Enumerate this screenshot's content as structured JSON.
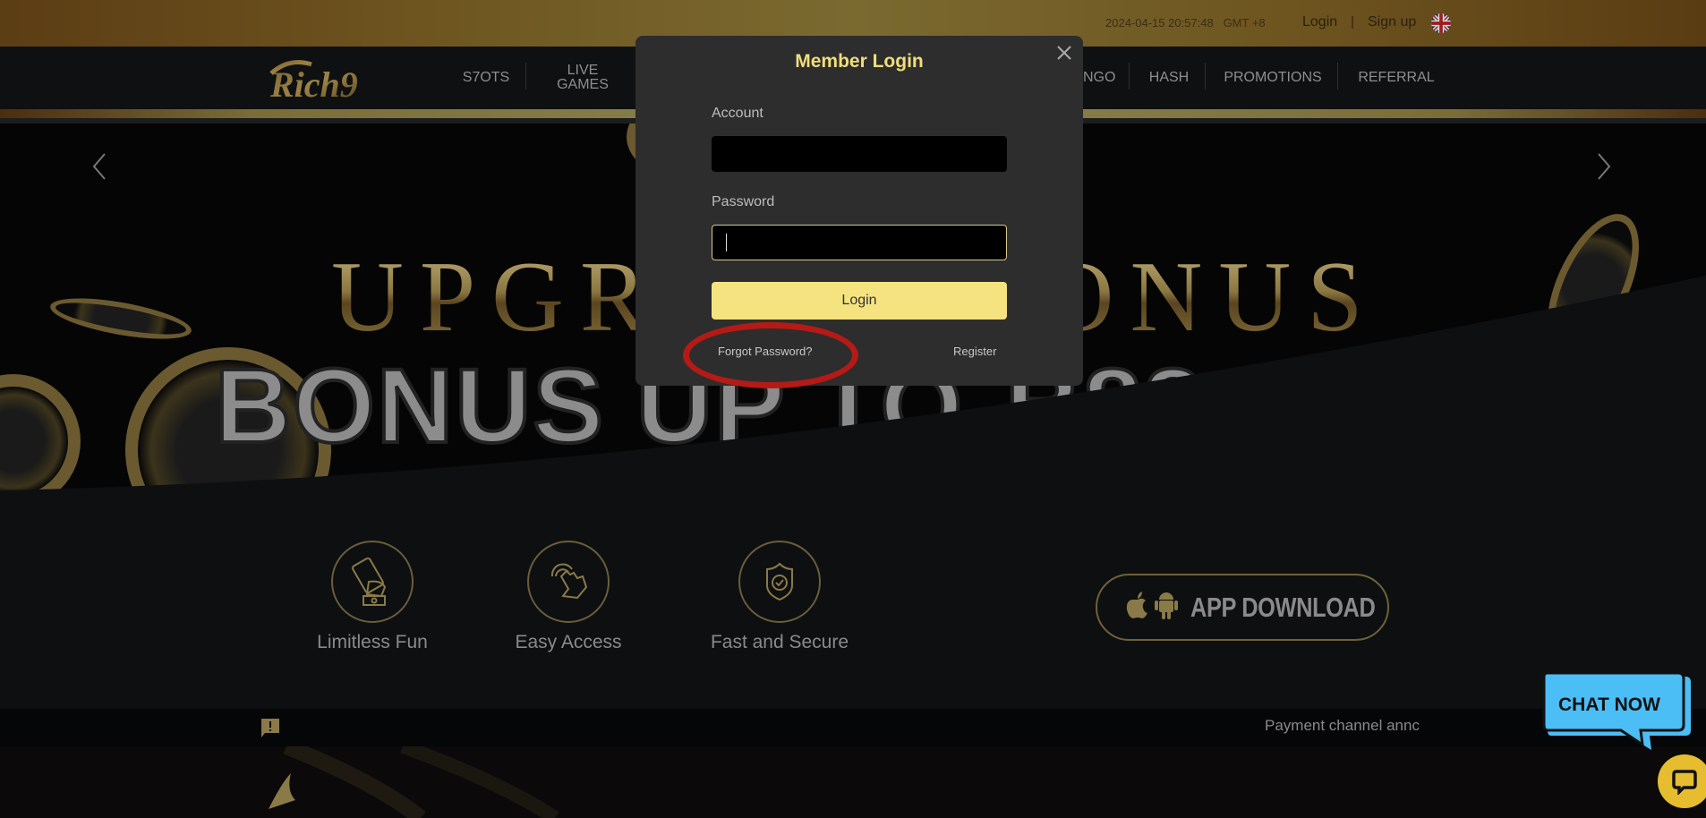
{
  "topbar": {
    "datetime": "2024-04-15 20:57:48",
    "timezone": "GMT +8",
    "login_label": "Login",
    "separator": "|",
    "signup_label": "Sign up",
    "language_icon": "uk-flag-icon"
  },
  "nav": {
    "logo_text": "Rich9",
    "items": [
      {
        "label": "S7OTS"
      },
      {
        "label": "LIVE GAMES"
      },
      {
        "label": "NGO"
      },
      {
        "label": "HASH"
      },
      {
        "label": "PROMOTIONS"
      },
      {
        "label": "REFERRAL"
      }
    ]
  },
  "banner": {
    "headline": "UPGRADE BONUS",
    "headline_visible_left": "UPGR",
    "headline_visible_right": "ONUS",
    "subline": "BONUS UP TO ₿88",
    "prev_icon": "chevron-left-icon",
    "next_icon": "chevron-right-icon"
  },
  "features": [
    {
      "label": "Limitless Fun",
      "icon": "hand-phone-cash-icon"
    },
    {
      "label": "Easy Access",
      "icon": "tap-hand-icon"
    },
    {
      "label": "Fast and Secure",
      "icon": "shield-check-icon"
    }
  ],
  "app_download": {
    "label": "APP DOWNLOAD",
    "icons": [
      "apple-icon",
      "android-icon"
    ]
  },
  "announcement": {
    "text": "Payment channel announcement",
    "visible_text": "Payment channel annc"
  },
  "modal": {
    "title": "Member Login",
    "account_label": "Account",
    "account_value": "",
    "password_label": "Password",
    "password_value": "",
    "login_button": "Login",
    "forgot_password": "Forgot Password?",
    "register": "Register"
  },
  "chat": {
    "bubble_label": "CHAT NOW"
  },
  "colors": {
    "accent_gold": "#f5e380",
    "title_gold": "#f0de7c",
    "annotation_red": "#b41a16",
    "chat_blue": "#4bbef5",
    "chat_yellow": "#e6bd2f"
  }
}
